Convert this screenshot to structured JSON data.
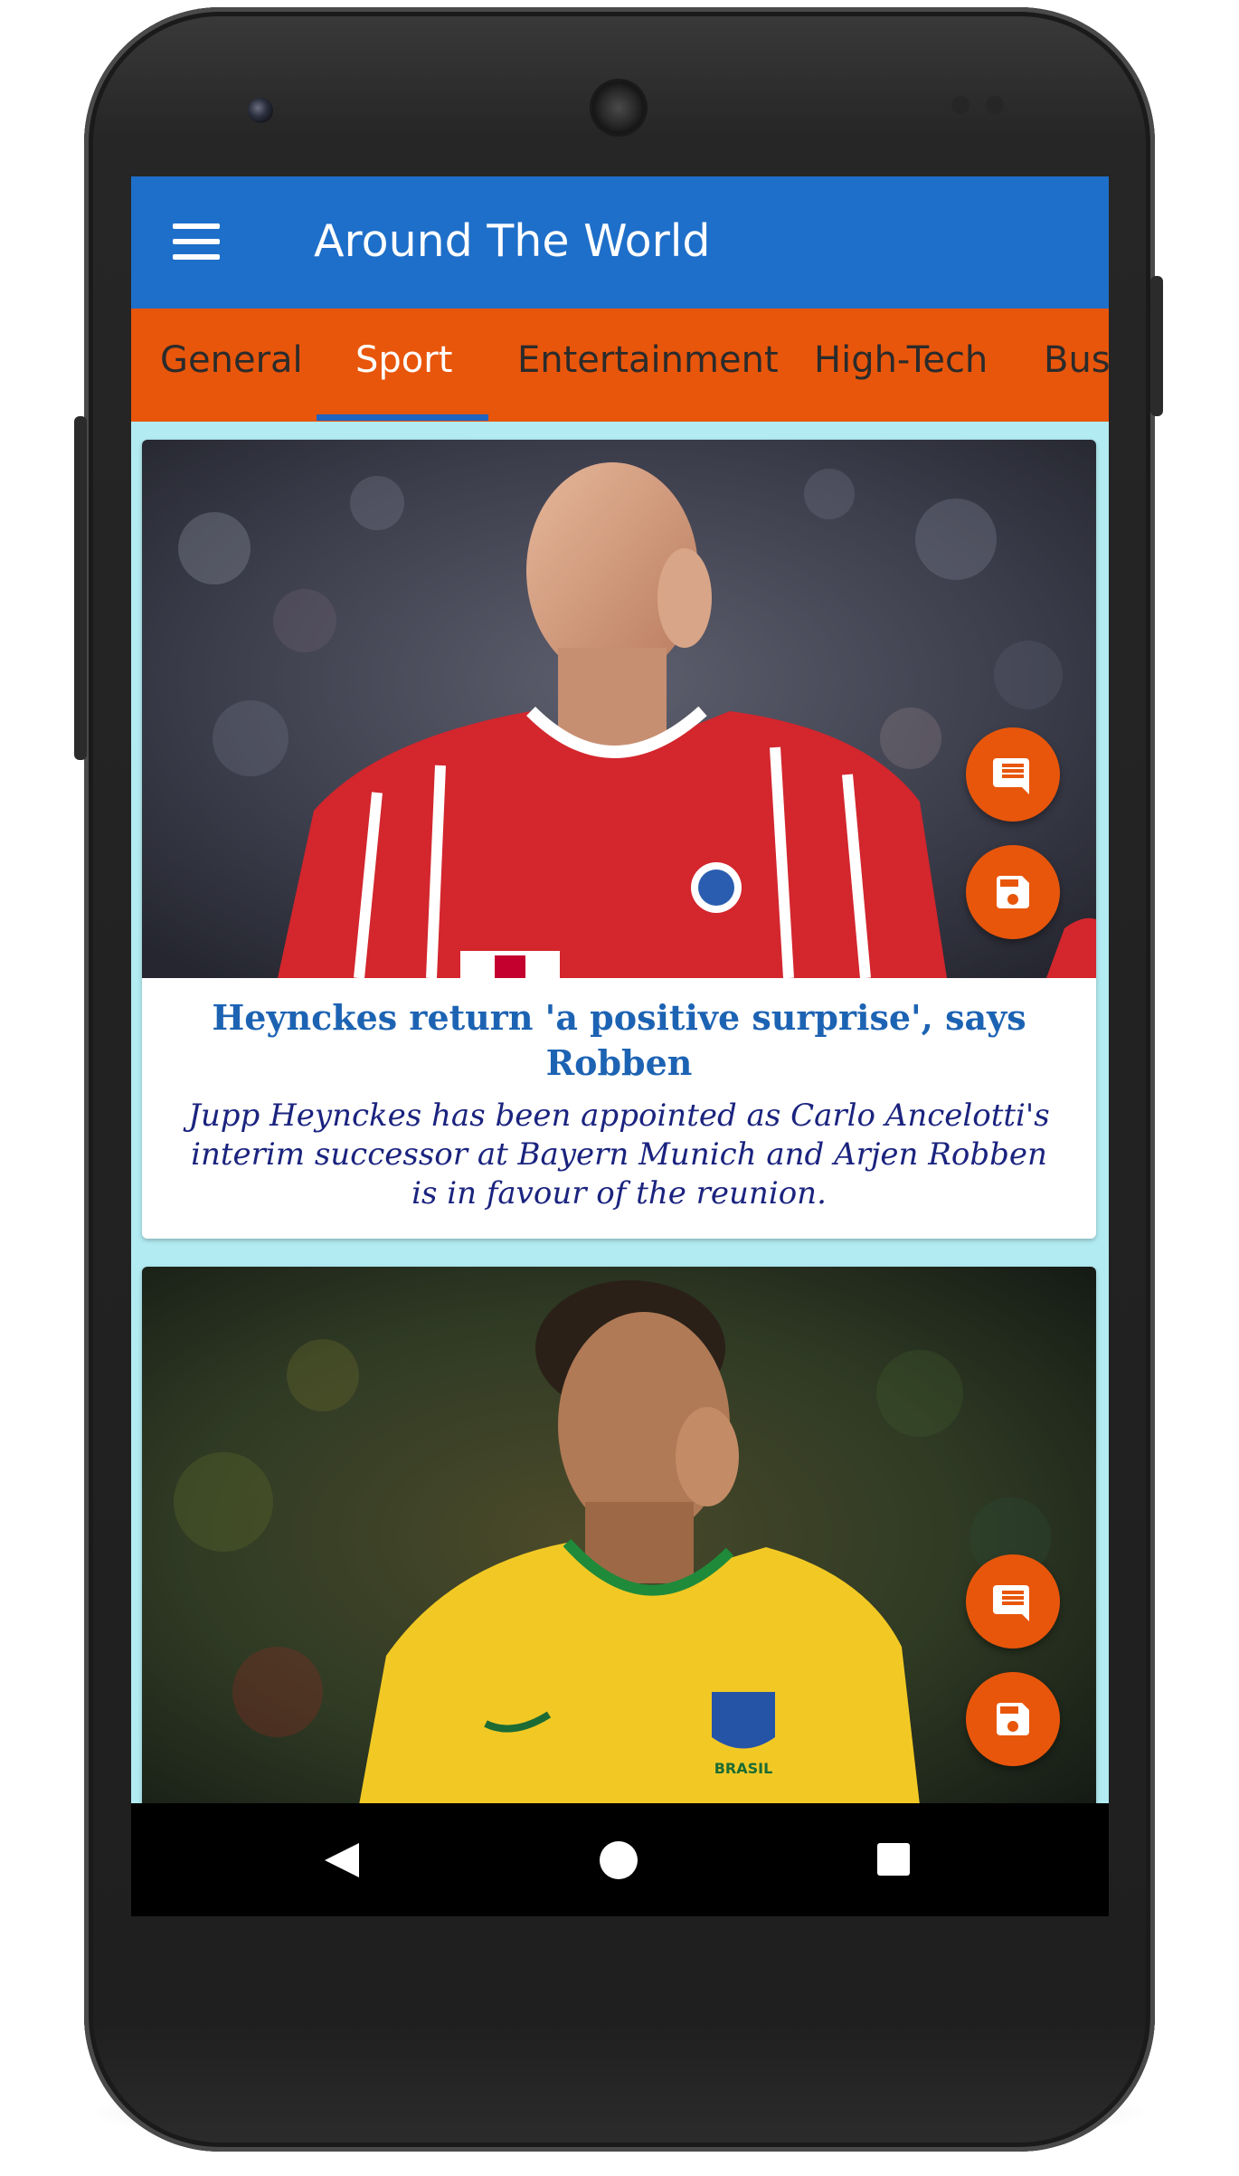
{
  "app": {
    "title": "Around The World",
    "colors": {
      "app_bar": "#1e6fc9",
      "tab_bar": "#e8560b",
      "tab_indicator": "#1f64c0",
      "list_background": "#b2ebf2",
      "fab": "#e8560b",
      "title_text": "#1d63b3",
      "description_text": "#1a237e"
    }
  },
  "tabs": [
    {
      "label": "General",
      "active": false
    },
    {
      "label": "Sport",
      "active": true
    },
    {
      "label": "Entertainment",
      "active": false
    },
    {
      "label": "High-Tech",
      "active": false
    },
    {
      "label": "Bus",
      "active": false
    }
  ],
  "articles": [
    {
      "title": "Heynckes return 'a positive surprise', says Robben",
      "description": "Jupp Heynckes has been appointed as Carlo Ancelotti's interim successor at Bayern Munich and Arjen Robben is in favour of the reunion.",
      "actions": {
        "comment_icon": "comment-icon",
        "save_icon": "save-icon"
      }
    },
    {
      "title": "",
      "description": "",
      "actions": {
        "comment_icon": "comment-icon",
        "save_icon": "save-icon"
      }
    }
  ],
  "navigation": {
    "back_icon": "back-triangle-icon",
    "home_icon": "home-circle-icon",
    "recents_icon": "recents-square-icon"
  }
}
